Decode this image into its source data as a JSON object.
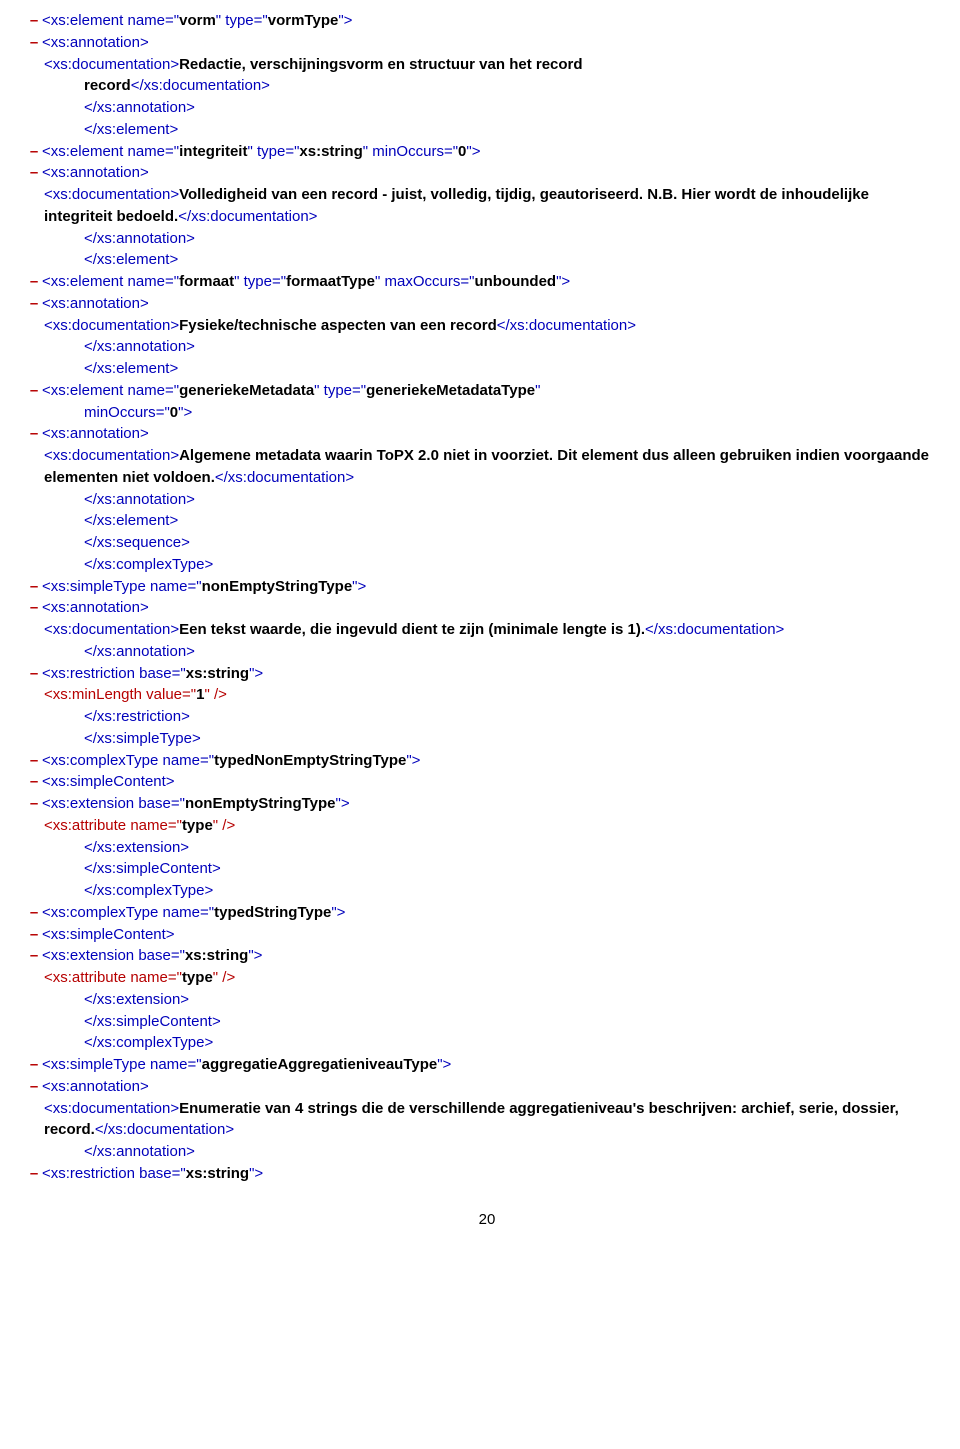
{
  "xs_element": "xs:element",
  "xs_annotation_o": "<xs:annotation>",
  "xs_annotation_c": "</xs:annotation>",
  "xs_documentation_o": "<xs:documentation>",
  "xs_documentation_c": "</xs:documentation>",
  "xs_element_c": "</xs:element>",
  "xs_sequence_c": "</xs:sequence>",
  "xs_complexType_c": "</xs:complexType>",
  "xs_simpleType": "xs:simpleType",
  "xs_simpleType_c": "</xs:simpleType>",
  "xs_restriction": "xs:restriction",
  "xs_restriction_c": "</xs:restriction>",
  "xs_minLength": "xs:minLength",
  "xs_complexType": "xs:complexType",
  "xs_simpleContent_o": "<xs:simpleContent>",
  "xs_simpleContent_c": "</xs:simpleContent>",
  "xs_extension": "xs:extension",
  "xs_extension_c": "</xs:extension>",
  "xs_attribute": "xs:attribute",
  "name_attr": "name",
  "type_attr": "type",
  "minOccurs_attr": "minOccurs",
  "maxOccurs_attr": "maxOccurs",
  "base_attr": "base",
  "value_attr": "value",
  "vorm": "vorm",
  "vormType": "vormType",
  "doc_vorm": "Redactie, verschijningsvorm en structuur van het record",
  "record_lbl": "record",
  "integriteit": "integriteit",
  "xs_string": "xs:string",
  "zero": "0",
  "doc_integriteit": "Volledigheid van een record - juist, volledig, tijdig, geautoriseerd. N.B. Hier wordt de inhoudelijke integriteit bedoeld.",
  "formaat": "formaat",
  "formaatType": "formaatType",
  "unbounded": "unbounded",
  "doc_formaat": "Fysieke/technische aspecten van een record",
  "generiekeMetadata": "generiekeMetadata",
  "generiekeMetadataType": "generiekeMetadataType",
  "doc_generiek": "Algemene metadata waarin ToPX 2.0 niet in voorziet. Dit element dus alleen gebruiken indien voorgaande elementen niet voldoen.",
  "nonEmptyStringType": "nonEmptyStringType",
  "doc_nonEmpty": "Een tekst waarde, die ingevuld dient te zijn (minimale lengte is 1).",
  "one": "1",
  "typedNonEmptyStringType": "typedNonEmptyStringType",
  "type_val": "type",
  "typedStringType": "typedStringType",
  "aggregatieAggregatieniveauType": "aggregatieAggregatieniveauType",
  "doc_aggregatie": "Enumeratie van 4 strings die de verschillende aggregatieniveau's beschrijven: archief, serie, dossier, record.",
  "page": "20",
  "dash": "–"
}
